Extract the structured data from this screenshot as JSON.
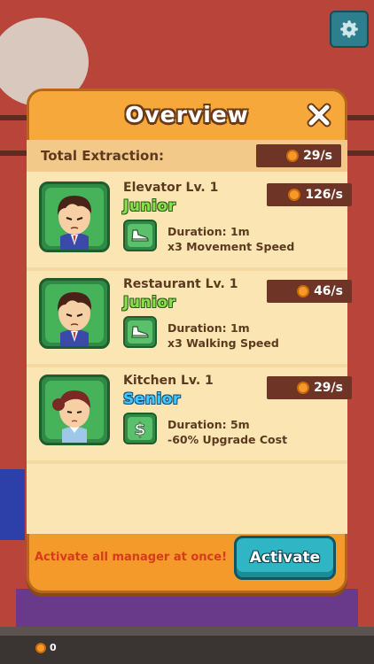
{
  "header": {
    "title": "Overview",
    "close_icon": "close-icon",
    "settings_icon": "gear-icon"
  },
  "summary": {
    "label": "Total Extraction:",
    "rate": "29/s"
  },
  "managers": [
    {
      "name": "Elevator Lv. 1",
      "rank": "Junior",
      "rate": "126/s",
      "duration": "Duration: 1m",
      "effect": "x3 Movement Speed",
      "skill_icon": "shoe-icon",
      "avatar": "male-manager-avatar"
    },
    {
      "name": "Restaurant Lv. 1",
      "rank": "Junior",
      "rate": "46/s",
      "duration": "Duration: 1m",
      "effect": "x3 Walking Speed",
      "skill_icon": "shoe-icon",
      "avatar": "male-manager-avatar"
    },
    {
      "name": "Kitchen Lv. 1",
      "rank": "Senior",
      "rate": "29/s",
      "duration": "Duration: 5m",
      "effect": "-60% Upgrade Cost",
      "skill_icon": "dollar-icon",
      "avatar": "female-manager-avatar"
    }
  ],
  "footer": {
    "hint": "Activate all manager at once!",
    "activate_label": "Activate"
  },
  "hud": {
    "coins": "0"
  },
  "colors": {
    "panel": "#f39a2a",
    "content": "#fbe6b3",
    "rate_box": "#6e3426",
    "junior": "#86e04a",
    "senior": "#3ec8ff",
    "activate": "#2fb5c4",
    "hint": "#d83a1d"
  }
}
